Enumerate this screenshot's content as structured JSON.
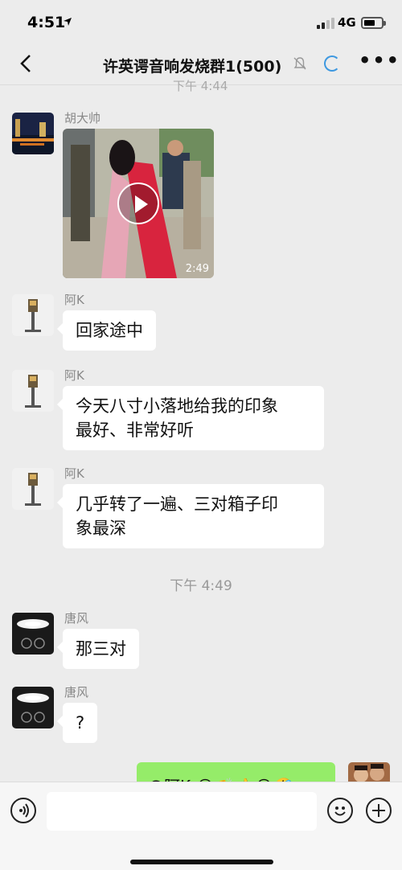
{
  "status": {
    "time": "4:51",
    "network": "4G"
  },
  "nav": {
    "title": "许英谔音响发烧群1(500)"
  },
  "hidden_time": "下午 4:44",
  "messages": [
    {
      "sender": "胡大帅",
      "type": "video",
      "duration": "2:49"
    },
    {
      "sender": "阿K",
      "text": "回家途中"
    },
    {
      "sender": "阿K",
      "text_line1": "今天八寸小落地给我的印象",
      "text_line2": "最好、非常好听"
    },
    {
      "sender": "阿K",
      "text_line1": "几乎转了一遍、三对箱子印",
      "text_line2": "象最深"
    },
    {
      "sender": "唐风",
      "text": "那三对"
    },
    {
      "sender": "唐风",
      "text": "?"
    }
  ],
  "time_separator": "下午 4:49",
  "my_message": {
    "text": "@阿K 😂👏👍😂🤣"
  },
  "input": {
    "placeholder": ""
  }
}
